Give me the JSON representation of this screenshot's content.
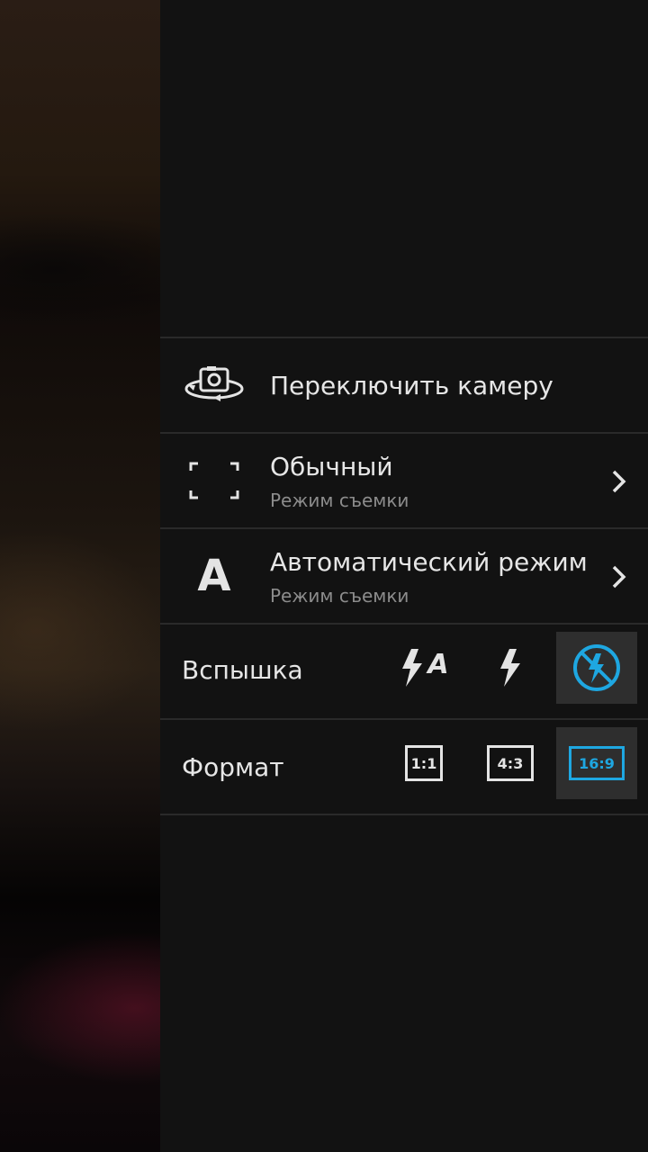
{
  "menu": {
    "switch_camera": {
      "label": "Переключить камеру",
      "icon": "switch-camera-icon"
    },
    "shooting_mode": {
      "label": "Обычный",
      "sub": "Режим съемки",
      "icon": "normal-mode-frame-icon"
    },
    "scene_mode": {
      "label": "Автоматический режим",
      "sub": "Режим съемки",
      "icon_text": "A"
    },
    "flash": {
      "label": "Вспышка",
      "options": [
        {
          "name": "flash-auto",
          "icon": "flash-auto-icon",
          "glyph_text": "A"
        },
        {
          "name": "flash-on",
          "icon": "flash-on-icon"
        },
        {
          "name": "flash-off",
          "icon": "flash-off-icon",
          "selected": true
        }
      ]
    },
    "format": {
      "label": "Формат",
      "options": [
        {
          "name": "1:1",
          "text": "1:1"
        },
        {
          "name": "4:3",
          "text": "4:3"
        },
        {
          "name": "16:9",
          "text": "16:9",
          "selected": true
        }
      ]
    }
  },
  "colors": {
    "panel_bg": "#121212",
    "divider": "#2a2a2a",
    "selected_bg": "#2e2e2e",
    "accent": "#1ea7e1",
    "text_primary": "#e6e6e6",
    "text_secondary": "#8c8c8c"
  }
}
